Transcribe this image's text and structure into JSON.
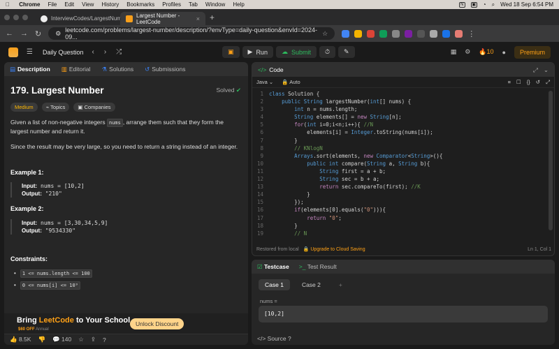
{
  "menubar": {
    "apple": "",
    "items": [
      "Chrome",
      "File",
      "Edit",
      "View",
      "History",
      "Bookmarks",
      "Profiles",
      "Tab",
      "Window",
      "Help"
    ],
    "datetime": "Wed 18 Sep  6:54 PM"
  },
  "browser": {
    "tabs": [
      {
        "title": "InterviewCodes/LargestNumb",
        "active": false
      },
      {
        "title": "Largest Number - LeetCode",
        "active": true
      }
    ],
    "url": "leetcode.com/problems/largest-number/description/?envType=daily-question&envId=2024-09..."
  },
  "header": {
    "title": "Daily Question",
    "run": "Run",
    "submit": "Submit",
    "streak": "10",
    "premium": "Premium"
  },
  "left": {
    "tabs": [
      {
        "label": "Description",
        "icon": "document-icon"
      },
      {
        "label": "Editorial",
        "icon": "book-icon"
      },
      {
        "label": "Solutions",
        "icon": "flask-icon"
      },
      {
        "label": "Submissions",
        "icon": "history-icon"
      }
    ],
    "problem_title": "179. Largest Number",
    "status": "Solved",
    "tags": {
      "difficulty": "Medium",
      "topics": "Topics",
      "companies": "Companies"
    },
    "desc_p1_a": "Given a list of non-negative integers ",
    "desc_p1_code": "nums",
    "desc_p1_b": ", arrange them such that they form the largest number and return it.",
    "desc_p2": "Since the result may be very large, so you need to return a string instead of an integer.",
    "example1": {
      "heading": "Example 1:",
      "input_label": "Input:",
      "input": " nums = [10,2]",
      "output_label": "Output:",
      "output": " \"210\""
    },
    "example2": {
      "heading": "Example 2:",
      "input_label": "Input:",
      "input": " nums = [3,30,34,5,9]",
      "output_label": "Output:",
      "output": " \"9534330\""
    },
    "constraints_heading": "Constraints:",
    "constraints": [
      "1 <= nums.length <= 100",
      "0 <= nums[i] <= 10⁹"
    ],
    "promo": {
      "title_a": "Bring ",
      "title_b": "LeetCode",
      "title_c": " to Your School",
      "sub_a": "$60 OFF",
      "sub_b": " Annual",
      "button": "Unlock Discount"
    },
    "footer": {
      "likes": "8.5K",
      "comments": "140"
    }
  },
  "code": {
    "panel_title": "Code",
    "language": "Java",
    "mode": "Auto",
    "footer_left": "Restored from local",
    "upgrade": "Upgrade to Cloud Saving",
    "position": "Ln 1, Col 1",
    "lines": [
      [
        [
          "ty",
          "class "
        ],
        [
          "tx",
          "Solution {"
        ]
      ],
      [
        [
          "tx",
          "    "
        ],
        [
          "ty",
          "public "
        ],
        [
          "ty",
          "String "
        ],
        [
          "tx",
          "largestNumber("
        ],
        [
          "ty",
          "int"
        ],
        [
          "tx",
          "[] nums) {"
        ]
      ],
      [
        [
          "tx",
          "        "
        ],
        [
          "ty",
          "int "
        ],
        [
          "tx",
          "n = nums.length;"
        ]
      ],
      [
        [
          "tx",
          "        "
        ],
        [
          "ty",
          "String "
        ],
        [
          "tx",
          "elements[] = "
        ],
        [
          "kw",
          "new "
        ],
        [
          "ty",
          "String"
        ],
        [
          "tx",
          "[n];"
        ]
      ],
      [
        [
          "tx",
          "        "
        ],
        [
          "kw",
          "for"
        ],
        [
          "tx",
          "("
        ],
        [
          "ty",
          "int "
        ],
        [
          "tx",
          "i=0;i<n;i++){ "
        ],
        [
          "cm",
          "//N"
        ]
      ],
      [
        [
          "tx",
          "            elements[i] = "
        ],
        [
          "ty",
          "Integer"
        ],
        [
          "tx",
          ".toString(nums[i]);"
        ]
      ],
      [
        [
          "tx",
          "        }"
        ]
      ],
      [
        [
          "tx",
          "        "
        ],
        [
          "cm",
          "// KNlogN"
        ]
      ],
      [
        [
          "tx",
          "        "
        ],
        [
          "ty",
          "Arrays"
        ],
        [
          "tx",
          ".sort(elements, "
        ],
        [
          "kw",
          "new "
        ],
        [
          "ty",
          "Comparator"
        ],
        [
          "tx",
          "<"
        ],
        [
          "ty",
          "String"
        ],
        [
          "tx",
          ">(){"
        ]
      ],
      [
        [
          "tx",
          "            "
        ],
        [
          "ty",
          "public "
        ],
        [
          "ty",
          "int "
        ],
        [
          "tx",
          "compare("
        ],
        [
          "ty",
          "String "
        ],
        [
          "tx",
          "a, "
        ],
        [
          "ty",
          "String "
        ],
        [
          "tx",
          "b){"
        ]
      ],
      [
        [
          "tx",
          "                "
        ],
        [
          "ty",
          "String "
        ],
        [
          "tx",
          "first = a + b;"
        ]
      ],
      [
        [
          "tx",
          "                "
        ],
        [
          "ty",
          "String "
        ],
        [
          "tx",
          "sec = b + a;"
        ]
      ],
      [
        [
          "tx",
          "                "
        ],
        [
          "kw",
          "return "
        ],
        [
          "tx",
          "sec.compareTo(first); "
        ],
        [
          "cm",
          "//K"
        ]
      ],
      [
        [
          "tx",
          "            }"
        ]
      ],
      [
        [
          "tx",
          "        });"
        ]
      ],
      [
        [
          "tx",
          "        "
        ],
        [
          "kw",
          "if"
        ],
        [
          "tx",
          "(elements[0].equals("
        ],
        [
          "st",
          "\"0\""
        ],
        [
          "tx",
          "))){"
        ]
      ],
      [
        [
          "tx",
          "            "
        ],
        [
          "kw",
          "return "
        ],
        [
          "st",
          "\"0\""
        ],
        [
          "tx",
          ";"
        ]
      ],
      [
        [
          "tx",
          "        }"
        ]
      ],
      [
        [
          "tx",
          "        "
        ],
        [
          "cm",
          "// N"
        ]
      ]
    ]
  },
  "testpanel": {
    "tab1": "Testcase",
    "tab2": "Test Result",
    "cases": [
      "Case 1",
      "Case 2"
    ],
    "add": "+",
    "var_label": "nums =",
    "var_value": "[10,2]",
    "source": "Source"
  }
}
